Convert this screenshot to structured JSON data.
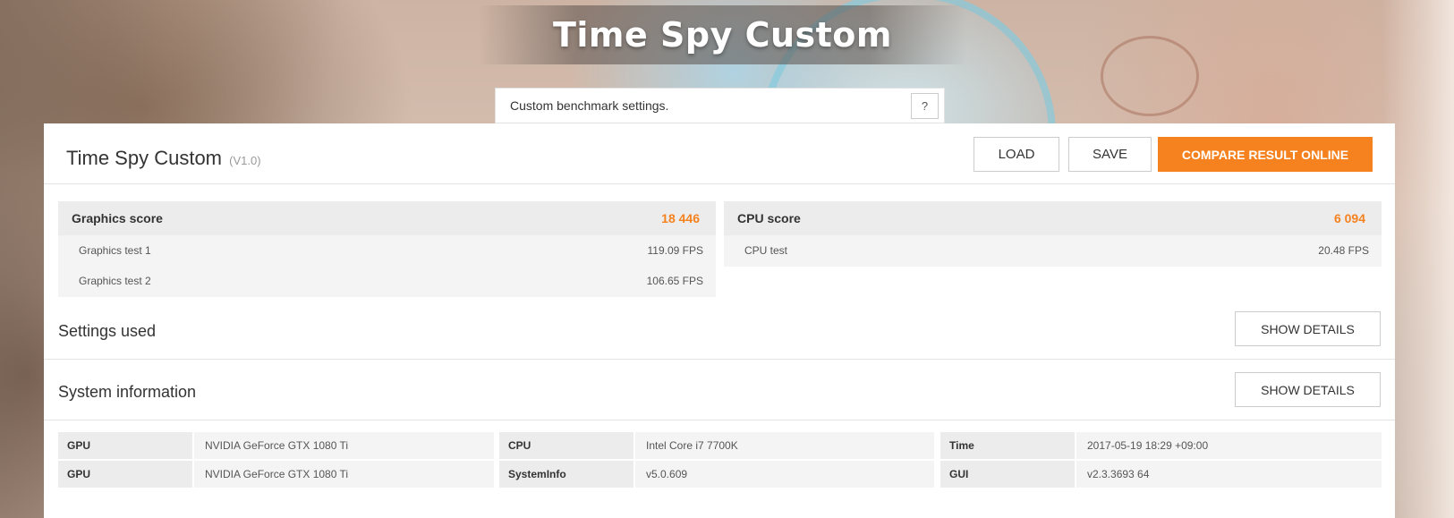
{
  "header": {
    "title": "Time Spy Custom"
  },
  "description": {
    "text": "Custom benchmark settings.",
    "help_label": "?"
  },
  "panel": {
    "title": "Time Spy Custom",
    "version": "(V1.0)",
    "load_label": "LOAD",
    "save_label": "SAVE",
    "compare_label": "COMPARE RESULT ONLINE",
    "accent_color": "#f5821f"
  },
  "graphics": {
    "label": "Graphics score",
    "score": "18 446",
    "tests": [
      {
        "name": "Graphics test 1",
        "value": "119.09 FPS"
      },
      {
        "name": "Graphics test 2",
        "value": "106.65 FPS"
      }
    ]
  },
  "cpu": {
    "label": "CPU score",
    "score": "6 094",
    "tests": [
      {
        "name": "CPU test",
        "value": "20.48 FPS"
      }
    ]
  },
  "settings_section": {
    "title": "Settings used",
    "details_label": "SHOW DETAILS"
  },
  "system_section": {
    "title": "System information",
    "details_label": "SHOW DETAILS"
  },
  "system_info": {
    "col1": [
      {
        "key": "GPU",
        "value": "NVIDIA GeForce GTX 1080 Ti"
      },
      {
        "key": "GPU",
        "value": "NVIDIA GeForce GTX 1080 Ti"
      }
    ],
    "col2": [
      {
        "key": "CPU",
        "value": "Intel Core i7 7700K"
      },
      {
        "key": "SystemInfo",
        "value": "v5.0.609"
      }
    ],
    "col3": [
      {
        "key": "Time",
        "value": "2017-05-19 18:29 +09:00"
      },
      {
        "key": "GUI",
        "value": "v2.3.3693 64"
      }
    ]
  }
}
